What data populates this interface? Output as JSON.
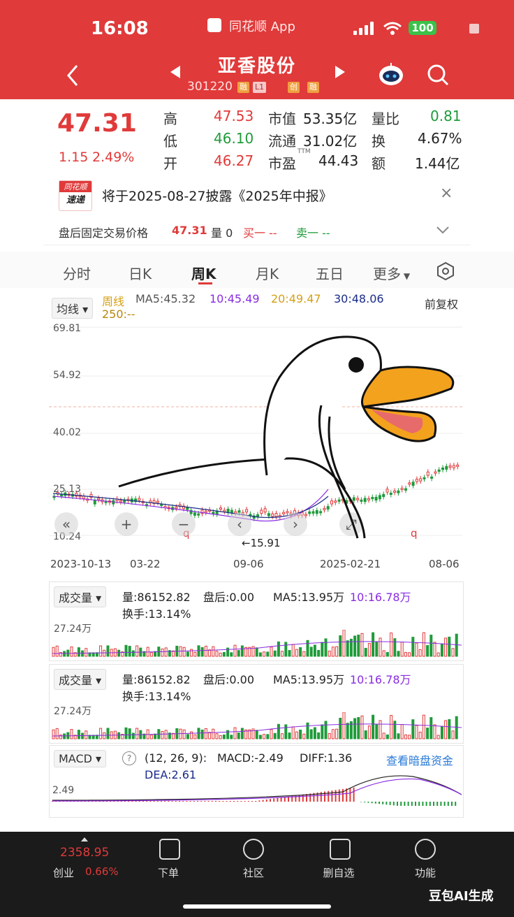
{
  "status": {
    "time": "16:08",
    "app_name": "同花顺 App",
    "battery": "100"
  },
  "header": {
    "title": "亚香股份",
    "code": "301220",
    "tags": [
      "融",
      "L1",
      "创",
      "融"
    ]
  },
  "quote": {
    "price": "47.31",
    "change": "1.15",
    "change_pct": "2.49%",
    "rows": [
      {
        "l1": "高",
        "v1": "47.53",
        "l2": "市值",
        "v2": "53.35亿",
        "l3": "量比",
        "v3": "0.81"
      },
      {
        "l1": "低",
        "v1": "46.10",
        "l2": "流通",
        "v2": "31.02亿",
        "l3": "换",
        "v3": "4.67%"
      },
      {
        "l1": "开",
        "v1": "46.27",
        "l2": "市盈",
        "l2sup": "TTM",
        "v2": "44.43",
        "l3": "额",
        "v3": "1.44亿"
      }
    ]
  },
  "notice": {
    "logo_top": "同花顺",
    "logo_bottom": "速递",
    "text": "将于2025-08-27披露《2025年中报》",
    "after_label": "盘后固定交易价格",
    "after_price": "47.31",
    "volume": "量 0",
    "buy": "买一 --",
    "sell": "卖一 --"
  },
  "tabs": [
    "分时",
    "日K",
    "周K",
    "月K",
    "五日",
    "更多"
  ],
  "active_tab": "周K",
  "kline": {
    "indicator": "均线",
    "period": "周线",
    "ma5": "MA5:45.32",
    "ma10": "10:45.49",
    "ma20": "20:49.47",
    "ma30": "30:48.06",
    "ma250": "250:--",
    "adjust": "前复权",
    "y_ticks": [
      "69.81",
      "54.92",
      "40.02",
      "25.13",
      "10.24"
    ],
    "x_ticks": [
      "2023-10-13",
      "03-22",
      "09-06",
      "2025-02-21",
      "08-06"
    ],
    "low_label": "←15.91",
    "q_marks": [
      "q",
      "q"
    ]
  },
  "volume1": {
    "indicator": "成交量",
    "vol": "量:86152.82",
    "after": "盘后:0.00",
    "ma5": "MA5:13.95万",
    "ma10": "10:16.78万",
    "turnover": "换手:13.14%",
    "y_tick": "27.24万"
  },
  "volume2": {
    "indicator": "成交量",
    "vol": "量:86152.82",
    "after": "盘后:0.00",
    "ma5": "MA5:13.95万",
    "ma10": "10:16.78万",
    "turnover": "换手:13.14%",
    "y_tick": "27.24万"
  },
  "macd": {
    "indicator": "MACD",
    "params": "(12, 26, 9):",
    "macd": "MACD:-2.49",
    "diff": "DIFF:1.36",
    "dea": "DEA:2.61",
    "link": "查看暗盘资金",
    "y_tick": "2.49"
  },
  "bottom": {
    "index_value": "2358.95",
    "index_name": "创业",
    "index_pct": "0.66%",
    "nav": [
      "下单",
      "社区",
      "删自选",
      "功能"
    ]
  },
  "watermark": "豆包AI生成",
  "colors": {
    "up": "#e03a3a",
    "down": "#1f9b3a",
    "header": "#e03a3a",
    "ma5": "#555555",
    "ma10": "#8a2be2",
    "ma20": "#d4a017",
    "ma30": "#1a2b8a"
  }
}
